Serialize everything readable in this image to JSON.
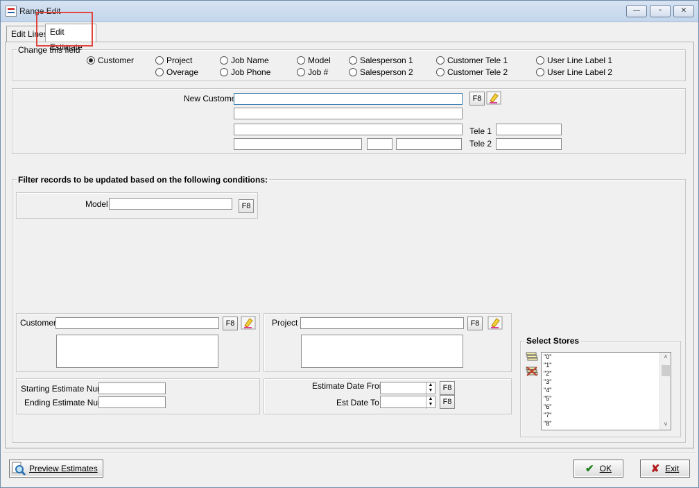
{
  "window": {
    "title": "Range Edit",
    "min": "—",
    "max": "▫",
    "close": "✕"
  },
  "tabs": [
    {
      "label": "Edit Lines"
    },
    {
      "label": "Edit Estimate"
    }
  ],
  "change_field": {
    "group_label": "Change this field",
    "options": [
      {
        "label": "Customer",
        "checked": true
      },
      {
        "label": "Project"
      },
      {
        "label": "Overage"
      },
      {
        "label": "Job Name"
      },
      {
        "label": "Job Phone"
      },
      {
        "label": "Model"
      },
      {
        "label": "Job #"
      },
      {
        "label": "Salesperson 1"
      },
      {
        "label": "Salesperson 2"
      },
      {
        "label": "Customer Tele 1"
      },
      {
        "label": "Customer Tele 2"
      },
      {
        "label": "User Line Label 1"
      },
      {
        "label": "User Line Label 2"
      }
    ]
  },
  "new_customer": {
    "label": "New Customer",
    "f8": "F8",
    "tele1": "Tele 1",
    "tele2": "Tele 2"
  },
  "filter": {
    "title": "Filter records to be updated based on the following conditions:",
    "model_label": "Model",
    "f8": "F8",
    "customer_label": "Customer",
    "project_label": "Project",
    "starting_estimate": "Starting Estimate Num",
    "ending_estimate": "Ending Estimate Num",
    "date_from": "Estimate Date From",
    "date_to": "Est Date To"
  },
  "stores": {
    "title": "Select Stores",
    "items": [
      "\"0\"",
      "\"1\"",
      "\"2\"",
      "\"3\"",
      "\"4\"",
      "\"5\"",
      "\"6\"",
      "\"7\"",
      "\"8\""
    ]
  },
  "footer": {
    "preview": "Preview Estimates",
    "ok": "OK",
    "exit": "Exit"
  },
  "colors": {
    "highlight": "#e0453d",
    "focus_border": "#3c7fb1"
  }
}
